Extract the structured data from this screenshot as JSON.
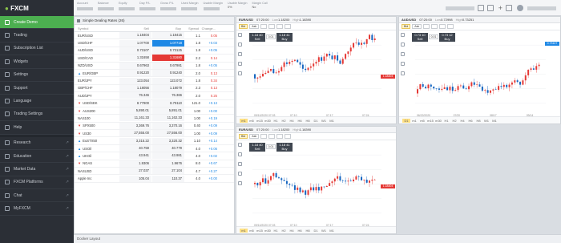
{
  "brand": {
    "logo_text": "FXCM"
  },
  "sidebar": {
    "items": [
      {
        "label": "Create Demo",
        "active": true,
        "icon": "user-plus-icon"
      },
      {
        "label": "Trading",
        "icon": "chart-icon"
      },
      {
        "label": "Subscription List",
        "icon": "list-icon"
      },
      {
        "label": "Widgets",
        "icon": "widgets-icon"
      },
      {
        "label": "Settings",
        "icon": "gear-icon"
      },
      {
        "label": "Support",
        "icon": "support-icon"
      },
      {
        "label": "Language",
        "icon": "globe-icon"
      },
      {
        "label": "Trading Settings",
        "icon": "sliders-icon"
      },
      {
        "label": "Help",
        "icon": "help-icon"
      }
    ],
    "external": [
      {
        "label": "Research",
        "icon": "research-icon"
      },
      {
        "label": "Education",
        "icon": "education-icon"
      },
      {
        "label": "Market Data",
        "icon": "market-data-icon"
      },
      {
        "label": "FXCM Platforms",
        "icon": "platforms-icon"
      },
      {
        "label": "Chat",
        "icon": "chat-icon"
      },
      {
        "label": "MyFXCM",
        "icon": "myfxcm-icon"
      }
    ]
  },
  "topbar": {
    "stats": [
      "Account",
      "Balance",
      "Equity",
      "Day P/L",
      "Gross P/L",
      "Used Margin",
      "Usable Margin",
      "Usable Margin",
      "Margin Call"
    ],
    "usable_margin_pct": "0%",
    "margin_call": "No"
  },
  "dealing": {
    "title": "Simple Dealing Rates (26)",
    "headers": {
      "symbol": "Symbol",
      "sell": "Sell",
      "buy": "Buy",
      "spread": "Spread",
      "change": "Change..."
    },
    "rows": [
      {
        "symbol": "EUR/USD",
        "arrow": "",
        "sell": "1.18404",
        "buy": "1.18415",
        "spread": "1.1",
        "change": "0.05",
        "chg_dir": "neg"
      },
      {
        "symbol": "USD/CHF",
        "arrow": "",
        "sell": "1.07700",
        "buy": "1.07718",
        "spread": "1.8",
        "change": "+0.03",
        "chg_dir": "pos",
        "buy_hl": "blue"
      },
      {
        "symbol": "AUD/USD",
        "arrow": "",
        "sell": "0.73107",
        "buy": "0.73125",
        "spread": "1.8",
        "change": "+0.05",
        "chg_dir": "pos"
      },
      {
        "symbol": "USD/CAD",
        "arrow": "",
        "sell": "1.31658",
        "buy": "1.31680",
        "spread": "2.2",
        "change": "0.14",
        "chg_dir": "neg",
        "buy_hl": "red"
      },
      {
        "symbol": "NZD/USD",
        "arrow": "",
        "sell": "0.67963",
        "buy": "0.67981",
        "spread": "1.8",
        "change": "+0.05",
        "chg_dir": "pos"
      },
      {
        "symbol": "EUR/GBP",
        "arrow": "up",
        "sell": "0.91220",
        "buy": "0.91240",
        "spread": "2.0",
        "change": "0.13",
        "chg_dir": "neg"
      },
      {
        "symbol": "EUR/JPY",
        "arrow": "",
        "sell": "123.054",
        "buy": "123.072",
        "spread": "1.8",
        "change": "0.34",
        "chg_dir": "neg"
      },
      {
        "symbol": "GBP/CHF",
        "arrow": "",
        "sell": "1.18056",
        "buy": "1.18079",
        "spread": "2.3",
        "change": "0.13",
        "chg_dir": "neg"
      },
      {
        "symbol": "AUD/JPY",
        "arrow": "",
        "sell": "76.346",
        "buy": "76.366",
        "spread": "2.0",
        "change": "0.25",
        "chg_dir": "neg"
      },
      {
        "symbol": "USD/SEK",
        "arrow": "down",
        "sell": "8.77900",
        "buy": "8.79110",
        "spread": "121.0",
        "change": "+0.13",
        "chg_dir": "pos"
      },
      {
        "symbol": "AUS200",
        "arrow": "down",
        "sell": "5,890.01",
        "buy": "5,891.01",
        "spread": "1.00",
        "change": "+0.00",
        "chg_dir": "pos"
      },
      {
        "symbol": "NAS100",
        "arrow": "",
        "sell": "11,161.33",
        "buy": "11,162.33",
        "spread": "1.00",
        "change": "+0.19",
        "chg_dir": "pos"
      },
      {
        "symbol": "SPX500",
        "arrow": "down",
        "sell": "3,369.76",
        "buy": "3,370.16",
        "spread": "0.40",
        "change": "+0.09",
        "chg_dir": "pos"
      },
      {
        "symbol": "US30",
        "arrow": "down",
        "sell": "27,555.00",
        "buy": "27,556.00",
        "spread": "1.00",
        "change": "+0.09",
        "chg_dir": "pos"
      },
      {
        "symbol": "EuSTX50",
        "arrow": "up",
        "sell": "3,315.22",
        "buy": "3,320.32",
        "spread": "1.10",
        "change": "+0.14",
        "chg_dir": "pos"
      },
      {
        "symbol": "USOil",
        "arrow": "up",
        "sell": "40.759",
        "buy": "40.779",
        "spread": "4.0",
        "change": "+0.06",
        "chg_dir": "pos"
      },
      {
        "symbol": "UKOil",
        "arrow": "up",
        "sell": "43.941",
        "buy": "43.981",
        "spread": "4.0",
        "change": "+0.02",
        "chg_dir": "pos"
      },
      {
        "symbol": "NGAS",
        "arrow": "down",
        "sell": "1.9306",
        "buy": "1.9676",
        "spread": "8.0",
        "change": "+0.67",
        "chg_dir": "pos"
      },
      {
        "symbol": "NASUSD",
        "arrow": "",
        "sell": "27.037",
        "buy": "27.104",
        "spread": "4.7",
        "change": "+0.27",
        "chg_dir": "pos"
      },
      {
        "symbol": "Apple Inc",
        "arrow": "",
        "sell": "105.04",
        "buy": "110.37",
        "spread": "4.0",
        "change": "+0.00",
        "chg_dir": "pos"
      }
    ]
  },
  "charts": [
    {
      "symbol": "EUR/USD",
      "time": "07:20:00",
      "low_label": "Low",
      "low": "1.18200",
      "high_label": "High",
      "high": "1.18390",
      "sell_label": "Sell",
      "buy_label": "Buy",
      "sell_price": "1.18 40",
      "sell_sup": "4",
      "buy_price": "1.18 41",
      "buy_sup": "5",
      "amount": "0.01",
      "timeframe": "m1",
      "price_tag": "1.18404",
      "x_ticks": [
        "09/10/2020 07:03",
        "07:10",
        "07:17",
        "07:24"
      ],
      "tools": [
        "Bid",
        "Ask",
        "",
        "",
        "",
        ""
      ],
      "timeframes": [
        "m1",
        "m5",
        "m15",
        "m30",
        "H1",
        "H2",
        "H4",
        "H6",
        "H8",
        "D1",
        "W1",
        "M1"
      ]
    },
    {
      "symbol": "AUD/USD",
      "time": "07:20:00",
      "low_label": "Low",
      "low": "0.72998",
      "high_label": "High",
      "high": "0.73251",
      "sell_label": "Sell",
      "buy_label": "Buy",
      "sell_price": "0.73 10",
      "sell_sup": "7",
      "buy_price": "0.73 12",
      "buy_sup": "5",
      "amount": "0.01",
      "timeframe": "D1",
      "price_tag": "0.73107",
      "x_ticks": [
        "06/22/2020",
        "07/20",
        "08/17",
        "09/14"
      ],
      "tools": [
        "Bid",
        "Ask",
        "",
        "",
        "",
        ""
      ],
      "timeframes": [
        "D1",
        "m1",
        "m5",
        "m15",
        "m30",
        "H1",
        "H2",
        "H4",
        "H6",
        "H8",
        "W1",
        "M1"
      ]
    },
    {
      "symbol": "EUR/USD",
      "time": "07:20:00",
      "low_label": "Low",
      "low": "1.18200",
      "high_label": "High",
      "high": "1.18390",
      "sell_label": "Sell",
      "buy_label": "Buy",
      "sell_price": "1.18 40",
      "sell_sup": "4",
      "buy_price": "1.18 41",
      "buy_sup": "5",
      "amount": "0.01",
      "timeframe": "m1",
      "price_tag": "1.18404",
      "x_ticks": [
        "09/10/2020 07:03",
        "07:10",
        "07:17",
        "07:24"
      ],
      "tools": [
        "Bid",
        "Ask",
        "",
        "",
        "",
        ""
      ],
      "timeframes": [
        "m1",
        "m5",
        "m15",
        "m30",
        "H1",
        "H2",
        "H4",
        "H6",
        "H8",
        "D1",
        "W1",
        "M1"
      ]
    }
  ],
  "bottombar": {
    "label": "Docker Layout"
  },
  "colors": {
    "green": "#4caf50",
    "up": "#e53935",
    "down": "#1565c0",
    "sidebar": "#2b2f36"
  }
}
